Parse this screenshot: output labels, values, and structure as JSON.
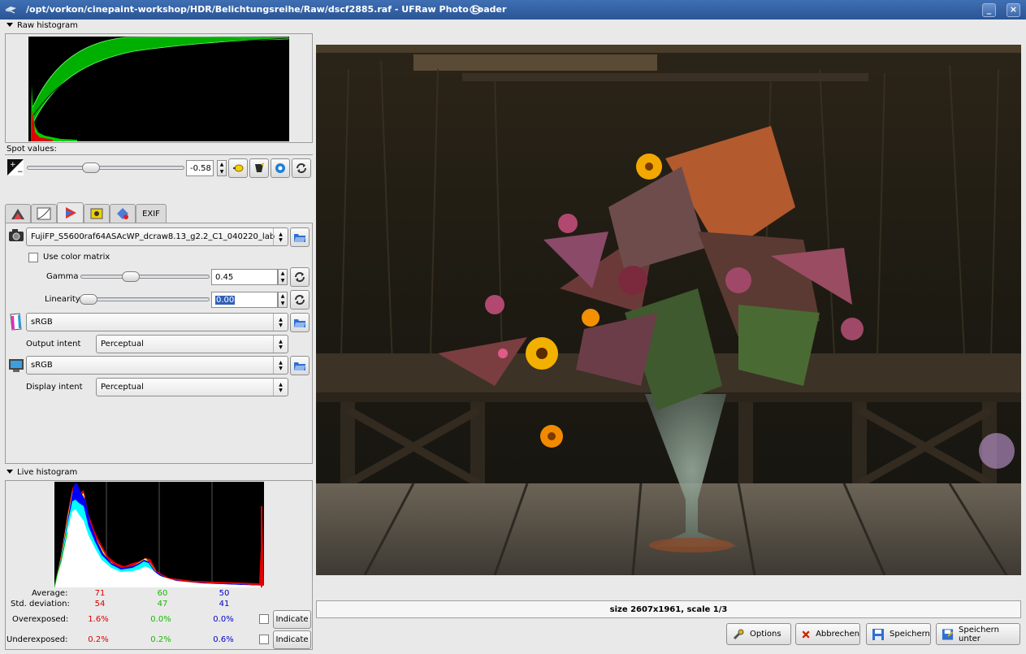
{
  "window": {
    "title": "/opt/vorkon/cinepaint-workshop/HDR/Belichtungsreihe/Raw/dscf2885.raf - UFRaw Photo Loader",
    "minimize": "_",
    "close": "×"
  },
  "raw_histogram": {
    "header": "Raw histogram"
  },
  "spot_values": {
    "label": "Spot values:"
  },
  "exposure": {
    "value": "-0.58",
    "level": -0.58
  },
  "tabs": [
    {
      "name": "white-balance-icon"
    },
    {
      "name": "grayscale-curve-icon"
    },
    {
      "name": "color-management-icon",
      "active": true
    },
    {
      "name": "corrections-icon"
    },
    {
      "name": "lightness-icon"
    },
    {
      "label": "EXIF"
    }
  ],
  "color_management": {
    "input_profile": "FujiFP_S5600raf64ASAcWP_dcraw8.13_g2.2_C1_040220_lab",
    "use_color_matrix": "Use color matrix",
    "gamma_label": "Gamma",
    "gamma_value": "0.45",
    "linearity_label": "Linearity",
    "linearity_value": "0.00",
    "output_profile": "sRGB",
    "output_intent_label": "Output intent",
    "output_intent": "Perceptual",
    "display_profile": "sRGB",
    "display_intent_label": "Display intent",
    "display_intent": "Perceptual"
  },
  "live_histogram": {
    "header": "Live histogram",
    "average_label": "Average:",
    "average": [
      "71",
      "60",
      "50"
    ],
    "std_label": "Std. deviation:",
    "std": [
      "54",
      "47",
      "41"
    ],
    "over_label": "Overexposed:",
    "over": [
      "1.6%",
      "0.0%",
      "0.0%"
    ],
    "under_label": "Underexposed:",
    "under": [
      "0.2%",
      "0.2%",
      "0.6%"
    ],
    "indicate": "Indicate"
  },
  "status": {
    "text": "size 2607x1961, scale 1/3"
  },
  "buttons": {
    "options": "Options",
    "cancel": "Abbrechen",
    "save": "Speichern",
    "save_as": "Speichern unter"
  },
  "colors": {
    "titlebar": "#2a5596",
    "histogram_green": "#00b000",
    "accent_blue": "#3a6ebc"
  }
}
